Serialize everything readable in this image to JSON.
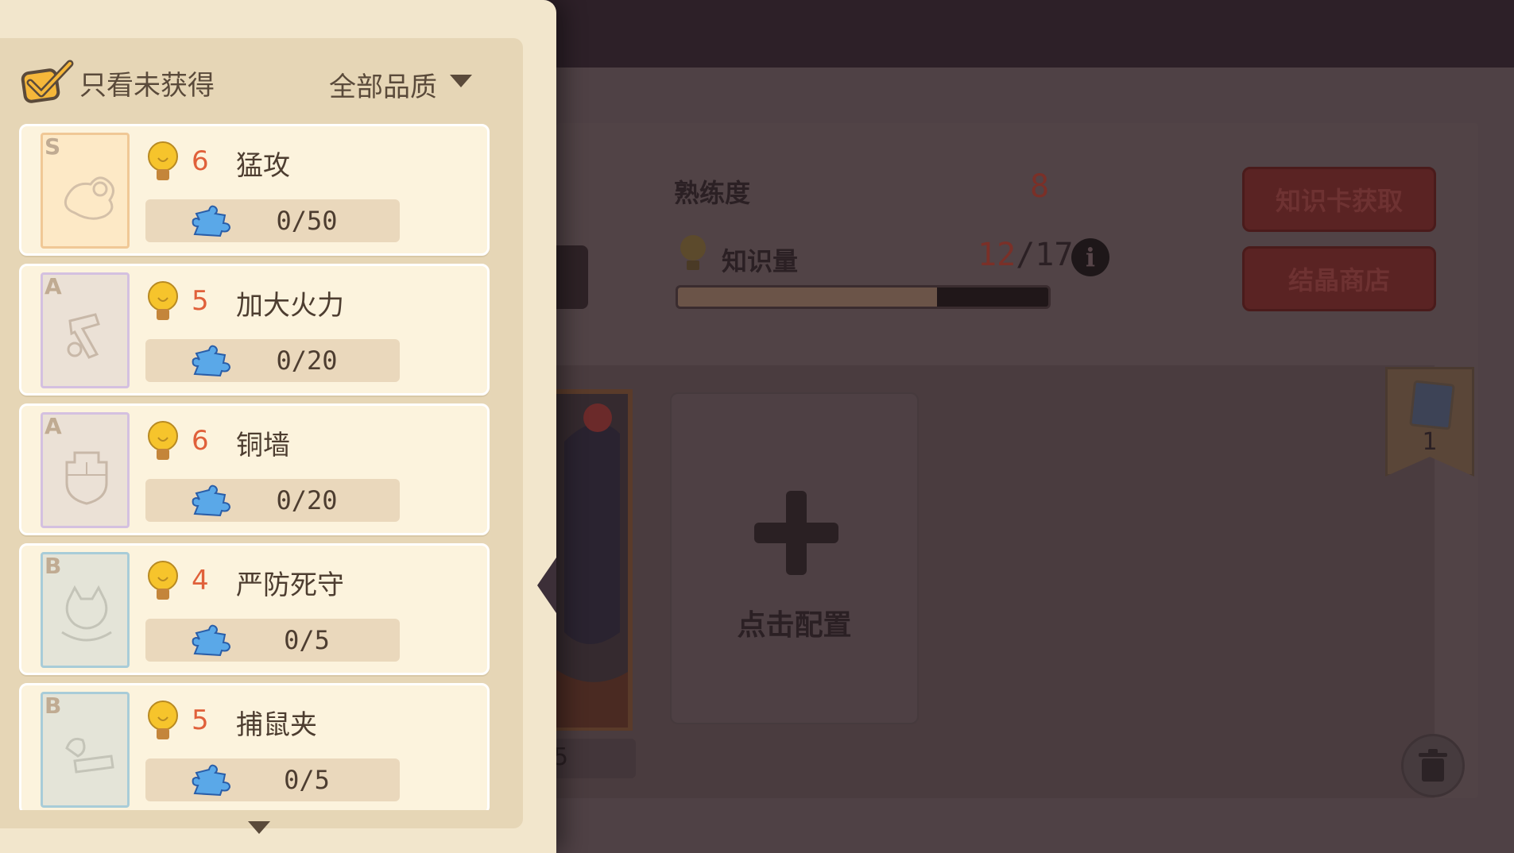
{
  "filter": {
    "only_unowned_label": "只看未获得",
    "quality_label": "全部品质"
  },
  "cards": [
    {
      "grade": "S",
      "cost": "6",
      "name": "猛攻",
      "fragments": "0/50"
    },
    {
      "grade": "A",
      "cost": "5",
      "name": "加大火力",
      "fragments": "0/20"
    },
    {
      "grade": "A",
      "cost": "6",
      "name": "铜墙",
      "fragments": "0/20"
    },
    {
      "grade": "B",
      "cost": "4",
      "name": "严防死守",
      "fragments": "0/5"
    },
    {
      "grade": "B",
      "cost": "5",
      "name": "捕鼠夹",
      "fragments": "0/5"
    }
  ],
  "stats": {
    "proficiency_label": "熟练度",
    "proficiency_value": "8",
    "knowledge_label": "知识量",
    "knowledge_current": "12",
    "knowledge_sep": "/",
    "knowledge_max": "17",
    "knowledge_progress": 0.7
  },
  "buttons": {
    "get_cards": "知识卡获取",
    "crystal_shop": "结晶商店"
  },
  "config": {
    "slot_label": "点击配置"
  },
  "deck": {
    "count": "1"
  },
  "character": {
    "level_fragment": "5"
  },
  "colors": {
    "cost": "#e0603a",
    "panel_bg": "#f2e6cc",
    "card_bg": "#fcf3dd"
  }
}
